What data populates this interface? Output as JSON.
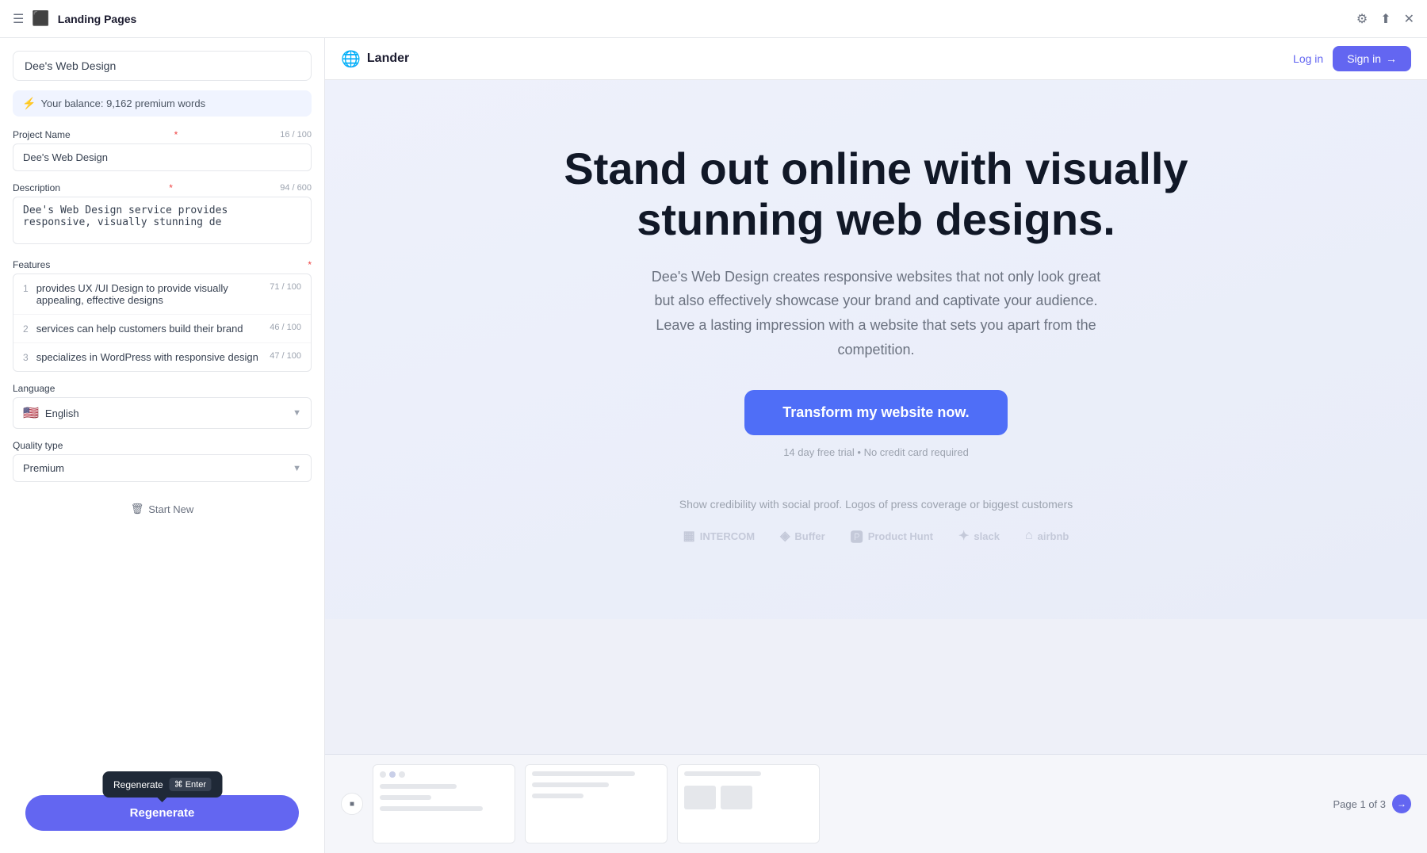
{
  "titlebar": {
    "title": "Landing Pages",
    "icon_label": "landing-pages-icon"
  },
  "left_panel": {
    "search_placeholder": "Dee's Web Design",
    "balance_text": "Your balance: 9,162 premium words",
    "project_name_label": "Project Name",
    "project_name_value": "Dee's Web Design",
    "project_name_counter": "16 / 100",
    "description_label": "Description",
    "description_counter": "94 / 600",
    "description_value": "Dee's Web Design service provides responsive, visually stunning de",
    "features_label": "Features",
    "features": [
      {
        "num": "1",
        "text": "provides UX /UI Design to provide visually appealing, effective designs",
        "counter": "71 / 100"
      },
      {
        "num": "2",
        "text": "services can help customers build their brand",
        "counter": "46 / 100"
      },
      {
        "num": "3",
        "text": "specializes in WordPress with responsive design",
        "counter": "47 / 100"
      }
    ],
    "language_label": "Language",
    "language_value": "English",
    "language_flag": "🇺🇸",
    "quality_label": "Quality type",
    "quality_value": "Premium",
    "start_new_label": "Start New",
    "tooltip": {
      "label": "Regenerate",
      "key_symbol": "⌘",
      "key_enter": "Enter"
    },
    "regenerate_btn": "Regenerate"
  },
  "preview": {
    "brand": "Lander",
    "login_label": "Log in",
    "signin_label": "Sign in",
    "hero_title": "Stand out online with visually stunning web designs.",
    "hero_subtitle": "Dee's Web Design creates responsive websites that not only look great but also effectively showcase your brand and captivate your audience. Leave a lasting impression with a website that sets you apart from the competition.",
    "hero_cta": "Transform my website now.",
    "hero_trial": "14 day free trial • No credit card required",
    "social_proof_label": "Show credibility with social proof. Logos of press coverage or biggest customers",
    "social_logos": [
      {
        "name": "INTERCOM",
        "icon": "⬛"
      },
      {
        "name": "Buffer",
        "icon": "◈"
      },
      {
        "name": "Product Hunt",
        "icon": "🅟"
      },
      {
        "name": "slack",
        "icon": "✦"
      },
      {
        "name": "airbnb",
        "icon": "⌂"
      }
    ],
    "page_indicator": "Page 1 of 3"
  }
}
